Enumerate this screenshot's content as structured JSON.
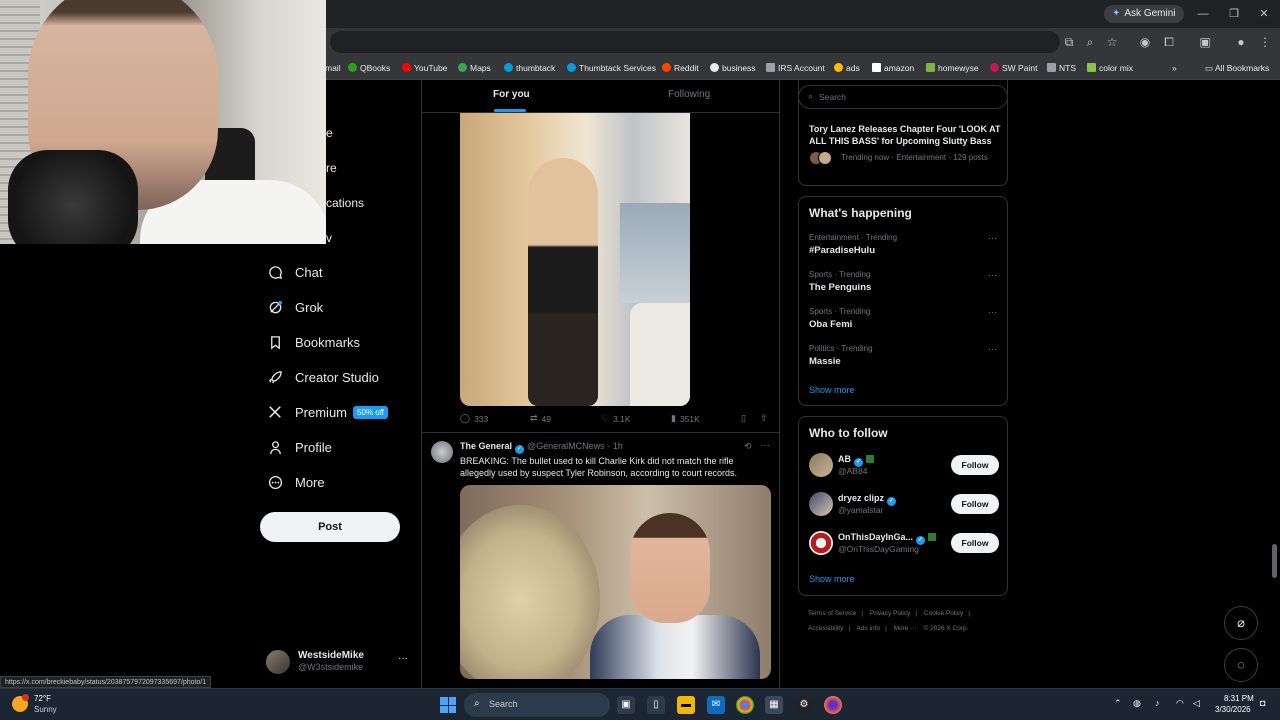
{
  "browser": {
    "ask_gemini": "Ask Gemini",
    "bookmarks": [
      "mail",
      "QBooks",
      "YouTube",
      "Maps",
      "thumbtack",
      "Thumbtack Services",
      "Reddit",
      "business",
      "IRS Account",
      "ads",
      "amazon",
      "homewyse",
      "SW Paint",
      "NTS",
      "color mix"
    ],
    "all_bookmarks": "All Bookmarks",
    "status_url": "https://x.com/breckiebaby/status/2038757972097335697/photo/1"
  },
  "nav": {
    "partials": [
      "e",
      "re",
      "cations",
      "v"
    ],
    "items": [
      {
        "label": "Chat",
        "icon": "chat-icon"
      },
      {
        "label": "Grok",
        "icon": "grok-icon"
      },
      {
        "label": "Bookmarks",
        "icon": "bookmark-icon"
      },
      {
        "label": "Creator Studio",
        "icon": "rocket-icon"
      },
      {
        "label": "Premium",
        "icon": "x-logo-icon"
      },
      {
        "label": "Profile",
        "icon": "person-icon"
      },
      {
        "label": "More",
        "icon": "more-circle-icon"
      }
    ],
    "premium_badge": "50% off",
    "post_label": "Post",
    "account": {
      "name": "WestsideMike",
      "handle": "@W3stsidemike"
    }
  },
  "feed": {
    "tabs": {
      "for_you": "For you",
      "following": "Following"
    },
    "tweet1": {
      "replies": "333",
      "reposts": "49",
      "likes": "3.1K",
      "views": "351K"
    },
    "tweet2": {
      "name": "The General",
      "handle": "@GeneralMCNews",
      "time": "1h",
      "text": "BREAKING: The bullet used to kill Charlie Kirk did not match the rifle allegedly used by suspect Tyler Robinson, according to court records."
    }
  },
  "sidebar": {
    "search_placeholder": "Search",
    "news": {
      "title": "Tory Lanez Releases Chapter Four 'LOOK AT ALL THIS BASS' for Upcoming Slutty Bass ...",
      "meta": "Trending now · Entertainment · 129 posts"
    },
    "happening": {
      "title": "What's happening",
      "trends": [
        {
          "category": "Entertainment · Trending",
          "name": "#ParadiseHulu"
        },
        {
          "category": "Sports · Trending",
          "name": "The Penguins"
        },
        {
          "category": "Sports · Trending",
          "name": "Oba Femi"
        },
        {
          "category": "Politics · Trending",
          "name": "Massie"
        }
      ],
      "show_more": "Show more"
    },
    "who_to_follow": {
      "title": "Who to follow",
      "users": [
        {
          "name": "AB",
          "handle": "@AB84",
          "follow": "Follow"
        },
        {
          "name": "dryez clipz",
          "handle": "@yamalstar",
          "follow": "Follow"
        },
        {
          "name": "OnThisDayInGa...",
          "handle": "@OnThisDayGaming",
          "follow": "Follow"
        }
      ],
      "show_more": "Show more"
    },
    "footer": [
      "Terms of Service",
      "|",
      "Privacy Policy",
      "|",
      "Cookie Policy",
      "|",
      "Accessibility",
      "|",
      "Ads info",
      "|",
      "More ···",
      "© 2026 X Corp."
    ]
  },
  "taskbar": {
    "temp": "72°F",
    "condition": "Sunny",
    "search": "Search",
    "time": "8:31 PM",
    "date": "3/30/2026"
  }
}
